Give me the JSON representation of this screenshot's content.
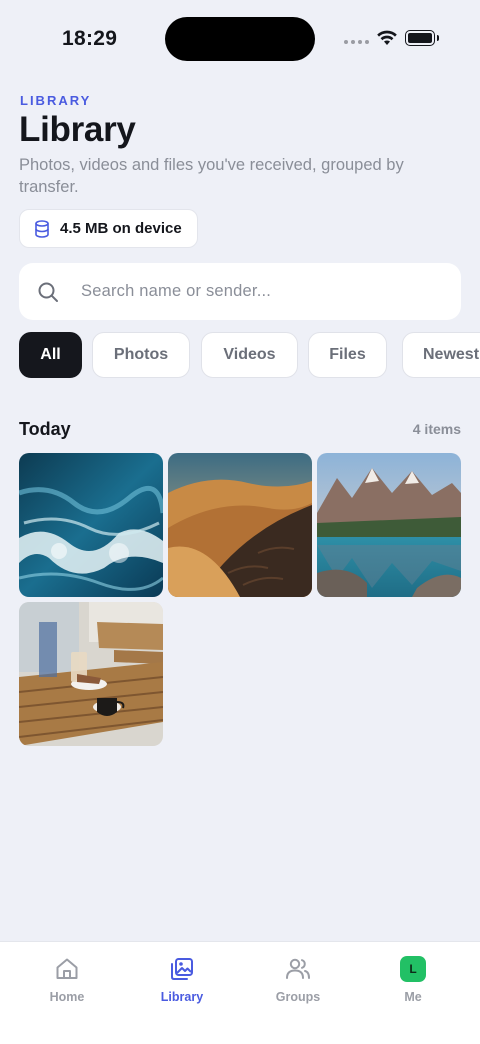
{
  "status_bar": {
    "time": "18:29"
  },
  "header": {
    "eyebrow": "LIBRARY",
    "title": "Library",
    "subtitle": "Photos, videos and files you've received, grouped by transfer."
  },
  "storage": {
    "label": "4.5 MB on device",
    "icon": "database-icon"
  },
  "search": {
    "placeholder": "Search name or sender..."
  },
  "filters": {
    "chips": [
      "All",
      "Photos",
      "Videos",
      "Files",
      "Newest"
    ],
    "selected": "All"
  },
  "section": {
    "title": "Today",
    "count": "4 items"
  },
  "photos": [
    {
      "subject": "ocean waves",
      "icon": "photo-ocean"
    },
    {
      "subject": "desert dunes",
      "icon": "photo-desert"
    },
    {
      "subject": "mountain lake",
      "icon": "photo-lake"
    },
    {
      "subject": "cafe table",
      "icon": "photo-cafe"
    }
  ],
  "tabbar": {
    "items": [
      {
        "label": "Home",
        "icon": "home-icon"
      },
      {
        "label": "Library",
        "icon": "library-icon"
      },
      {
        "label": "Groups",
        "icon": "groups-icon"
      },
      {
        "label": "Me",
        "icon": "avatar",
        "initial": "L"
      }
    ],
    "active": "Library"
  },
  "colors": {
    "accent": "#4a5be0",
    "avatar": "#22c065",
    "active_chip": "#15171d"
  }
}
